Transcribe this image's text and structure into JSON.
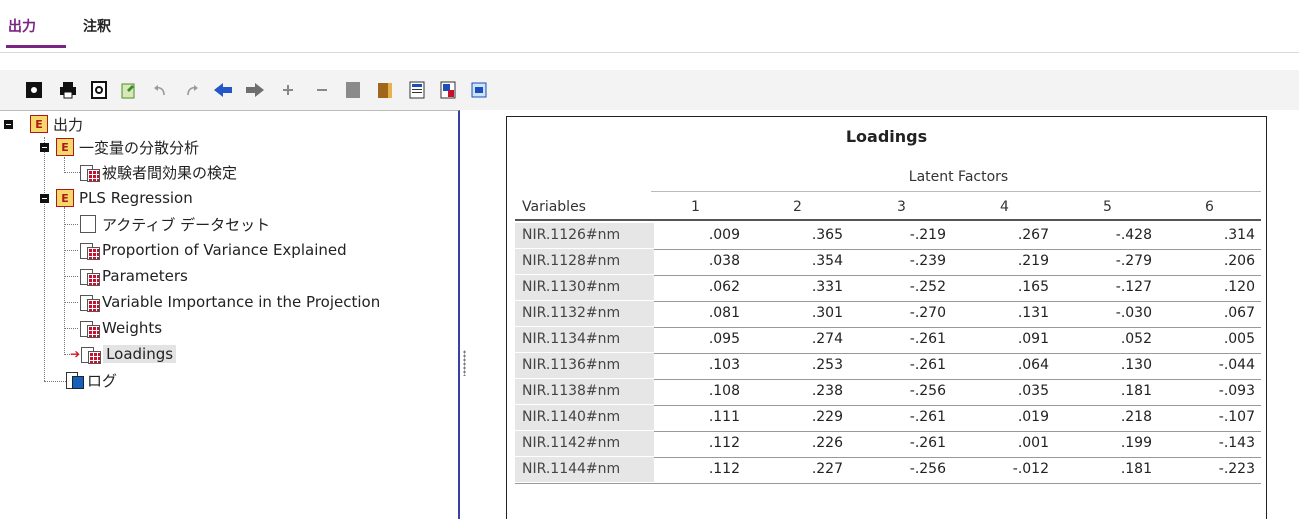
{
  "tabs": [
    {
      "label": "出力",
      "active": true
    },
    {
      "label": "注釈",
      "active": false
    }
  ],
  "toolbar": {
    "icons": [
      "export-icon",
      "print-icon",
      "print-preview-icon",
      "export-data-icon",
      "undo-icon",
      "redo-icon",
      "back-arrow-icon",
      "forward-arrow-icon",
      "expand-icon",
      "collapse-icon",
      "show-icon",
      "hide-icon",
      "insert-heading-icon",
      "insert-title-icon",
      "insert-text-icon"
    ]
  },
  "tree": {
    "root": "出力",
    "nodes": {
      "anova": "一変量の分散分析",
      "anova_child": "被験者間効果の検定",
      "pls": "PLS Regression",
      "pls_children": [
        "アクティブ データセット",
        "Proportion of Variance Explained",
        "Parameters",
        "Variable Importance in the Projection",
        "Weights",
        "Loadings"
      ],
      "log": "ログ"
    },
    "selected": "Loadings"
  },
  "table": {
    "title": "Loadings",
    "spanner": "Latent Factors",
    "row_header": "Variables",
    "columns": [
      "1",
      "2",
      "3",
      "4",
      "5",
      "6"
    ],
    "rows": [
      {
        "label": "NIR.1126#nm",
        "values": [
          ".009",
          ".365",
          "-.219",
          ".267",
          "-.428",
          ".314"
        ]
      },
      {
        "label": "NIR.1128#nm",
        "values": [
          ".038",
          ".354",
          "-.239",
          ".219",
          "-.279",
          ".206"
        ]
      },
      {
        "label": "NIR.1130#nm",
        "values": [
          ".062",
          ".331",
          "-.252",
          ".165",
          "-.127",
          ".120"
        ]
      },
      {
        "label": "NIR.1132#nm",
        "values": [
          ".081",
          ".301",
          "-.270",
          ".131",
          "-.030",
          ".067"
        ]
      },
      {
        "label": "NIR.1134#nm",
        "values": [
          ".095",
          ".274",
          "-.261",
          ".091",
          ".052",
          ".005"
        ]
      },
      {
        "label": "NIR.1136#nm",
        "values": [
          ".103",
          ".253",
          "-.261",
          ".064",
          ".130",
          "-.044"
        ]
      },
      {
        "label": "NIR.1138#nm",
        "values": [
          ".108",
          ".238",
          "-.256",
          ".035",
          ".181",
          "-.093"
        ]
      },
      {
        "label": "NIR.1140#nm",
        "values": [
          ".111",
          ".229",
          "-.261",
          ".019",
          ".218",
          "-.107"
        ]
      },
      {
        "label": "NIR.1142#nm",
        "values": [
          ".112",
          ".226",
          "-.261",
          ".001",
          ".199",
          "-.143"
        ]
      },
      {
        "label": "NIR.1144#nm",
        "values": [
          ".112",
          ".227",
          "-.256",
          "-.012",
          ".181",
          "-.223"
        ]
      }
    ]
  }
}
